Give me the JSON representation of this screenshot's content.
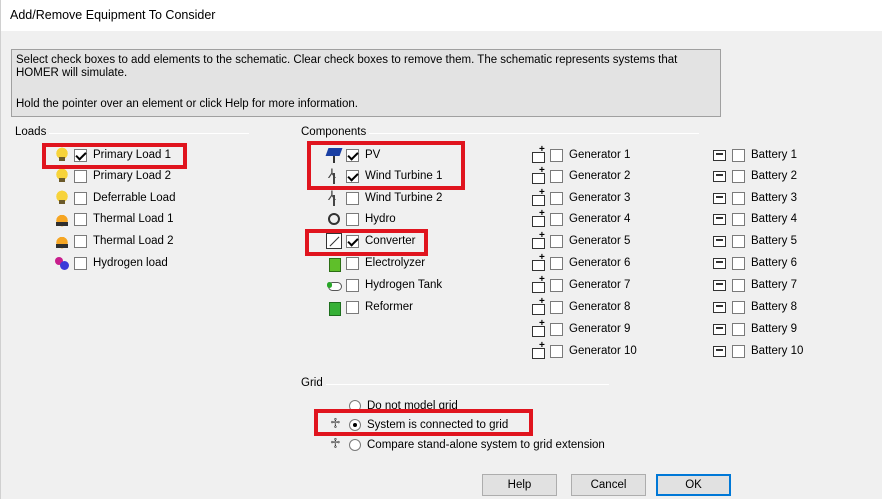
{
  "window": {
    "title": "Add/Remove Equipment To Consider"
  },
  "info": {
    "line1": "Select check boxes to add elements to the schematic. Clear check boxes to remove them. The schematic represents systems that HOMER will simulate.",
    "line2": "Hold the pointer over an element or click Help for more information."
  },
  "loads": {
    "label": "Loads",
    "items": [
      {
        "label": "Primary Load 1",
        "checked": true,
        "icon": "bulb-icon"
      },
      {
        "label": "Primary Load 2",
        "checked": false,
        "icon": "bulb-icon"
      },
      {
        "label": "Deferrable Load",
        "checked": false,
        "icon": "bulb-icon"
      },
      {
        "label": "Thermal Load 1",
        "checked": false,
        "icon": "flame-icon"
      },
      {
        "label": "Thermal Load 2",
        "checked": false,
        "icon": "flame-icon"
      },
      {
        "label": "Hydrogen load",
        "checked": false,
        "icon": "hydrogen-icon"
      }
    ]
  },
  "components": {
    "label": "Components",
    "items": [
      {
        "label": "PV",
        "checked": true,
        "icon": "pv-panel-icon"
      },
      {
        "label": "Wind Turbine 1",
        "checked": true,
        "icon": "wind-turbine-icon"
      },
      {
        "label": "Wind Turbine 2",
        "checked": false,
        "icon": "wind-turbine-icon"
      },
      {
        "label": "Hydro",
        "checked": false,
        "icon": "hydro-icon"
      },
      {
        "label": "Converter",
        "checked": true,
        "icon": "converter-icon"
      },
      {
        "label": "Electrolyzer",
        "checked": false,
        "icon": "electrolyzer-icon"
      },
      {
        "label": "Hydrogen Tank",
        "checked": false,
        "icon": "hydrogen-tank-icon"
      },
      {
        "label": "Reformer",
        "checked": false,
        "icon": "reformer-icon"
      }
    ],
    "generators": [
      "Generator 1",
      "Generator 2",
      "Generator 3",
      "Generator 4",
      "Generator 5",
      "Generator 6",
      "Generator 7",
      "Generator 8",
      "Generator 9",
      "Generator 10"
    ],
    "batteries": [
      "Battery 1",
      "Battery 2",
      "Battery 3",
      "Battery 4",
      "Battery 5",
      "Battery 6",
      "Battery 7",
      "Battery 8",
      "Battery 9",
      "Battery 10"
    ]
  },
  "grid": {
    "label": "Grid",
    "options": [
      {
        "label": "Do not model grid",
        "selected": false
      },
      {
        "label": "System is connected to grid",
        "selected": true
      },
      {
        "label": "Compare stand-alone system to grid extension",
        "selected": false
      }
    ]
  },
  "buttons": {
    "help": "Help",
    "cancel": "Cancel",
    "ok": "OK"
  },
  "colors": {
    "highlight": "#e0141e",
    "panel": "#e3e3e3",
    "window": "#f0f0f0"
  }
}
